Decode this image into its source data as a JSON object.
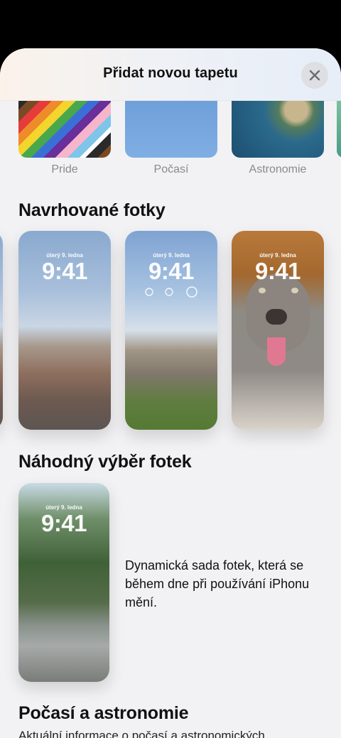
{
  "header": {
    "title": "Přidat novou tapetu",
    "close_icon": "xmark-icon"
  },
  "categories": [
    {
      "label": "Pride"
    },
    {
      "label": "Počasí"
    },
    {
      "label": "Astronomie"
    }
  ],
  "suggested": {
    "title": "Navrhované fotky",
    "cards": [
      {
        "date": "úterý 9. ledna",
        "time": "9:41"
      },
      {
        "date": "úterý 9. ledna",
        "time": "9:41"
      },
      {
        "date": "úterý 9. ledna",
        "time": "9:41"
      }
    ]
  },
  "shuffle": {
    "title": "Náhodný výběr fotek",
    "card": {
      "date": "úterý 9. ledna",
      "time": "9:41"
    },
    "description": "Dynamická sada fotek, která se během dne při používání iPhonu mění."
  },
  "weather_astronomy": {
    "title": "Počasí a astronomie",
    "subtitle": "Aktuální informace o počasí a astronomických"
  }
}
